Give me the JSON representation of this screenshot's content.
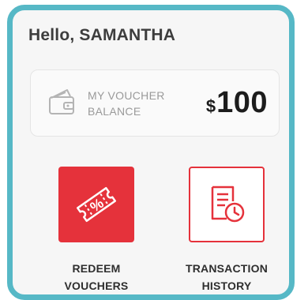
{
  "greeting": "Hello, SAMANTHA",
  "balance": {
    "label": "MY VOUCHER\nBALANCE",
    "currency": "$",
    "amount": "100"
  },
  "actions": [
    {
      "label": "REDEEM\nVOUCHERS",
      "icon": "ticket-percent-icon"
    },
    {
      "label": "TRANSACTION\nHISTORY",
      "icon": "document-clock-icon"
    }
  ],
  "colors": {
    "accent": "#e5323b",
    "border": "#56b8c6",
    "text": "#3d3d3d"
  }
}
